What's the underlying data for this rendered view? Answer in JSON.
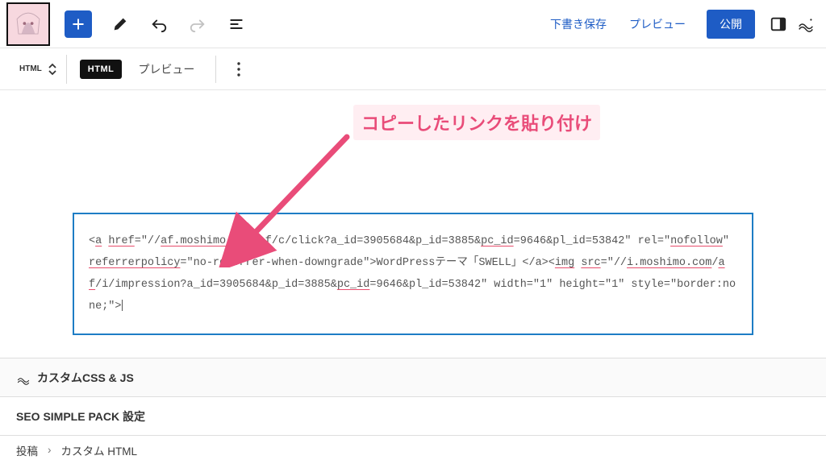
{
  "toolbar": {
    "draft_save": "下書き保存",
    "preview": "プレビュー",
    "publish": "公開"
  },
  "block_toolbar": {
    "mover_label": "HTML",
    "chip": "HTML",
    "preview_tab": "プレビュー"
  },
  "annotation": {
    "text": "コピーしたリンクを貼り付け",
    "color": "#e94c79"
  },
  "code": {
    "parts": [
      {
        "t": "<",
        "u": false
      },
      {
        "t": "a",
        "u": true
      },
      {
        "t": " ",
        "u": false
      },
      {
        "t": "href",
        "u": true
      },
      {
        "t": "=\"//",
        "u": false
      },
      {
        "t": "af.moshimo.com",
        "u": true
      },
      {
        "t": "/",
        "u": false
      },
      {
        "t": "af",
        "u": true
      },
      {
        "t": "/c/click?a_id=3905684&p_id=3885&",
        "u": false
      },
      {
        "t": "pc_id",
        "u": true
      },
      {
        "t": "=9646&pl_id=53842\" rel=\"",
        "u": false
      },
      {
        "t": "nofollow",
        "u": true
      },
      {
        "t": "\" ",
        "u": false
      },
      {
        "t": "referrerpolicy",
        "u": true
      },
      {
        "t": "=\"no-referrer-when-downgrade\">WordPressテーマ「SWELL」</a><",
        "u": false
      },
      {
        "t": "img",
        "u": true
      },
      {
        "t": " ",
        "u": false
      },
      {
        "t": "src",
        "u": true
      },
      {
        "t": "=\"//",
        "u": false
      },
      {
        "t": "i.moshimo.com",
        "u": true
      },
      {
        "t": "/",
        "u": false
      },
      {
        "t": "af",
        "u": true
      },
      {
        "t": "/i/impression?a_id=3905684&p_id=3885&",
        "u": false
      },
      {
        "t": "pc_id",
        "u": true
      },
      {
        "t": "=9646&pl_id=53842\" width=\"1\" height=\"1\" style=\"border:none;\">",
        "u": false
      }
    ]
  },
  "panels": {
    "custom_css_js": "カスタムCSS & JS",
    "seo_simple_pack": "SEO SIMPLE PACK 設定"
  },
  "breadcrumb": {
    "root": "投稿",
    "current": "カスタム HTML"
  },
  "colors": {
    "accent": "#1e5cc5",
    "code_border": "#1e7dc5",
    "annotation": "#e94c79"
  }
}
